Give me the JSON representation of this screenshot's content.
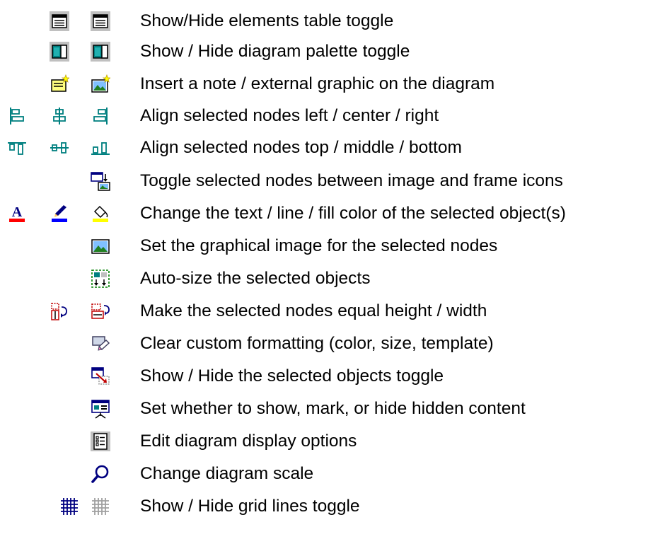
{
  "legend": {
    "rows": [
      {
        "icons": [
          "elements-table-icon",
          "elements-table-icon"
        ],
        "description": "Show/Hide elements table toggle"
      },
      {
        "icons": [
          "diagram-palette-icon",
          "diagram-palette-icon"
        ],
        "description": "Show / Hide diagram palette toggle"
      },
      {
        "icons": [
          "insert-note-icon",
          "insert-graphic-icon"
        ],
        "description": "Insert a note / external graphic on the diagram"
      },
      {
        "icons": [
          "align-left-icon",
          "align-center-icon",
          "align-right-icon"
        ],
        "description": "Align selected nodes left / center / right"
      },
      {
        "icons": [
          "align-top-icon",
          "align-middle-icon",
          "align-bottom-icon"
        ],
        "description": "Align selected nodes top / middle / bottom"
      },
      {
        "icons": [
          "toggle-image-frame-icon"
        ],
        "description": "Toggle selected nodes between image and frame icons"
      },
      {
        "icons": [
          "text-color-icon",
          "line-color-icon",
          "fill-color-icon"
        ],
        "description": "Change the text / line / fill color of the selected object(s)"
      },
      {
        "icons": [
          "set-image-icon"
        ],
        "description": "Set the graphical image for the selected nodes"
      },
      {
        "icons": [
          "auto-size-icon"
        ],
        "description": "Auto-size the selected objects"
      },
      {
        "icons": [
          "equal-height-icon",
          "equal-width-icon"
        ],
        "description": "Make the selected nodes equal height / width"
      },
      {
        "icons": [
          "clear-formatting-icon"
        ],
        "description": "Clear custom formatting (color, size, template)"
      },
      {
        "icons": [
          "show-hide-objects-icon"
        ],
        "description": "Show / Hide the selected objects toggle"
      },
      {
        "icons": [
          "hidden-content-icon"
        ],
        "description": "Set whether to show, mark, or hide hidden content"
      },
      {
        "icons": [
          "display-options-icon"
        ],
        "description": "Edit diagram display options"
      },
      {
        "icons": [
          "zoom-icon"
        ],
        "description": "Change diagram scale"
      },
      {
        "icons": [
          "grid-lines-on-icon",
          "grid-lines-off-icon"
        ],
        "description": "Show / Hide grid lines toggle"
      }
    ]
  }
}
